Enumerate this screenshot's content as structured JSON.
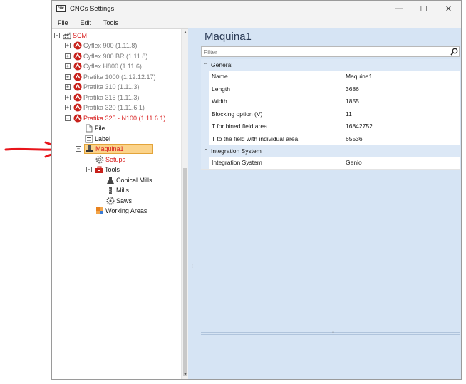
{
  "window": {
    "app_icon_text": "CNC",
    "title": "CNCs Settings",
    "controls": {
      "minimize": "—",
      "maximize": "☐",
      "close": "✕"
    }
  },
  "menu": [
    "File",
    "Edit",
    "Tools"
  ],
  "tree": {
    "root": {
      "label": "SCM",
      "expander": "⊟"
    },
    "machines": [
      {
        "label": "Cyflex 900 (1.11.8)",
        "expander": "+"
      },
      {
        "label": "Cyflex 900 BR (1.11.8)",
        "expander": "+"
      },
      {
        "label": "Cyflex H800 (1.11.6)",
        "expander": "+"
      },
      {
        "label": "Pratika 1000 (1.12.12.17)",
        "expander": "+"
      },
      {
        "label": "Pratika 310 (1.11.3)",
        "expander": "+"
      },
      {
        "label": "Pratika 315 (1.11.3)",
        "expander": "+"
      },
      {
        "label": "Pratika 320 (1.11.6.1)",
        "expander": "+"
      },
      {
        "label": "Pratika 325 - N100 (1.11.6.1)",
        "expander": "−"
      }
    ],
    "file_label": "File",
    "label_label": "Label",
    "maquina": {
      "label": "Maquina1",
      "expander": "−"
    },
    "setups_label": "Setups",
    "tools": {
      "label": "Tools",
      "expander": "−"
    },
    "tool_items": [
      "Conical Mills",
      "Mills",
      "Saws"
    ],
    "working_areas_label": "Working Areas"
  },
  "properties": {
    "object_title": "Maquina1",
    "filter_placeholder": "Filter",
    "categories": [
      {
        "name": "General",
        "rows": [
          {
            "name": "Name",
            "value": "Maquina1"
          },
          {
            "name": "Length",
            "value": "3686"
          },
          {
            "name": "Width",
            "value": "1855"
          },
          {
            "name": "Blocking option (V)",
            "value": "11"
          },
          {
            "name": "T for bined field area",
            "value": "16842752"
          },
          {
            "name": "T to the field with individual area",
            "value": "65536"
          }
        ]
      },
      {
        "name": "Integration System",
        "rows": [
          {
            "name": "Integration System",
            "value": "Genio"
          }
        ]
      }
    ]
  },
  "colors": {
    "accent_red": "#d81e1e",
    "selection": "#fbd38a",
    "pane_blue": "#d6e4f4",
    "annotation_arrow": "#e8151b"
  }
}
